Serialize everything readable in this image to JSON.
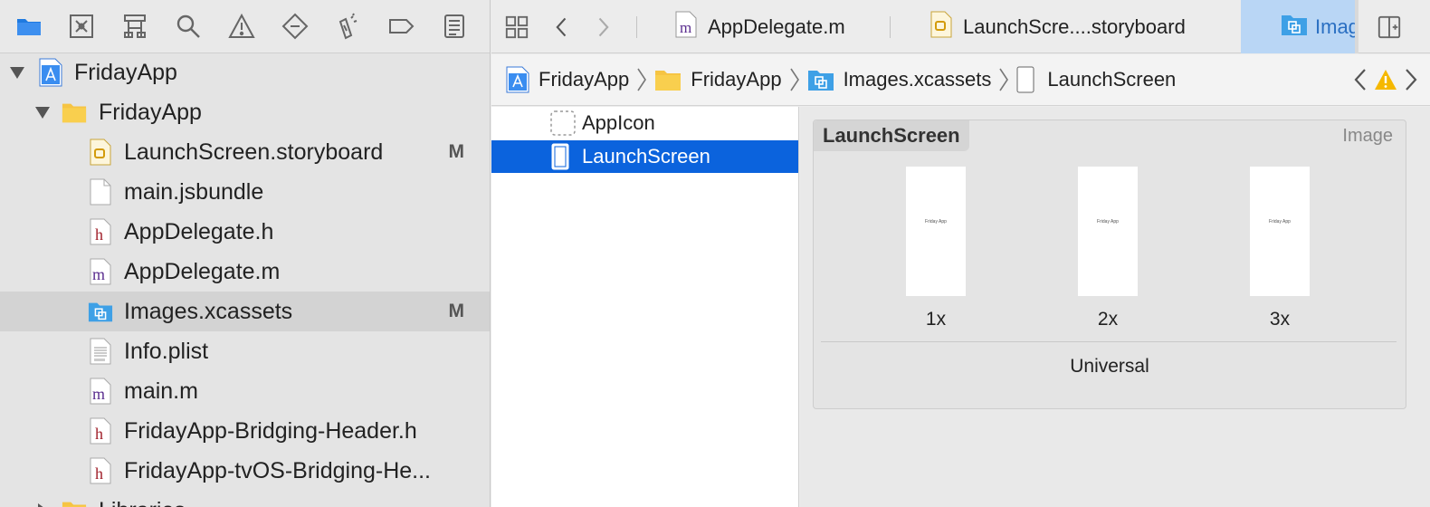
{
  "navigator": {
    "toolbar": [
      {
        "name": "project-navigator-icon",
        "active": true
      },
      {
        "name": "source-control-icon",
        "active": false
      },
      {
        "name": "symbol-navigator-icon",
        "active": false
      },
      {
        "name": "find-navigator-icon",
        "active": false
      },
      {
        "name": "issue-navigator-icon",
        "active": false
      },
      {
        "name": "test-navigator-icon",
        "active": false
      },
      {
        "name": "debug-navigator-icon",
        "active": false
      },
      {
        "name": "breakpoint-navigator-icon",
        "active": false
      },
      {
        "name": "report-navigator-icon",
        "active": false
      }
    ],
    "rows": [
      {
        "label": "FridayApp",
        "icon": "project-icon",
        "level": 0,
        "disclosure": "down",
        "badge": ""
      },
      {
        "label": "FridayApp",
        "icon": "folder-icon",
        "level": 1,
        "disclosure": "down",
        "badge": ""
      },
      {
        "label": "LaunchScreen.storyboard",
        "icon": "storyboard-file-icon",
        "level": 2,
        "disclosure": "",
        "badge": "M"
      },
      {
        "label": "main.jsbundle",
        "icon": "plain-file-icon",
        "level": 2,
        "disclosure": "",
        "badge": ""
      },
      {
        "label": "AppDelegate.h",
        "icon": "header-file-icon",
        "level": 2,
        "disclosure": "",
        "badge": ""
      },
      {
        "label": "AppDelegate.m",
        "icon": "objc-file-icon",
        "level": 2,
        "disclosure": "",
        "badge": ""
      },
      {
        "label": "Images.xcassets",
        "icon": "asset-catalog-icon",
        "level": 2,
        "disclosure": "",
        "badge": "M",
        "selected": true
      },
      {
        "label": "Info.plist",
        "icon": "plist-file-icon",
        "level": 2,
        "disclosure": "",
        "badge": ""
      },
      {
        "label": "main.m",
        "icon": "objc-file-icon",
        "level": 2,
        "disclosure": "",
        "badge": ""
      },
      {
        "label": "FridayApp-Bridging-Header.h",
        "icon": "header-file-icon",
        "level": 2,
        "disclosure": "",
        "badge": ""
      },
      {
        "label": "FridayApp-tvOS-Bridging-He...",
        "icon": "header-file-icon",
        "level": 2,
        "disclosure": "",
        "badge": ""
      },
      {
        "label": "Libraries",
        "icon": "folder-icon",
        "level": 1,
        "disclosure": "right",
        "badge": ""
      }
    ]
  },
  "tabs": [
    {
      "label": "AppDelegate.m",
      "icon": "objc-file-icon"
    },
    {
      "label": "LaunchScre....storyboard",
      "icon": "storyboard-file-icon"
    },
    {
      "label": "Imag",
      "icon": "asset-catalog-icon",
      "active": true
    }
  ],
  "jumpbar": {
    "crumbs": [
      {
        "label": "FridayApp",
        "icon": "project-icon"
      },
      {
        "label": "FridayApp",
        "icon": "folder-icon"
      },
      {
        "label": "Images.xcassets",
        "icon": "asset-catalog-icon"
      },
      {
        "label": "LaunchScreen",
        "icon": "image-set-icon"
      }
    ]
  },
  "asset_list": [
    {
      "label": "AppIcon",
      "icon": "app-icon-set-icon",
      "selected": false
    },
    {
      "label": "LaunchScreen",
      "icon": "image-set-icon",
      "selected": true
    }
  ],
  "detail": {
    "set_name": "LaunchScreen",
    "set_type": "Image",
    "slots": [
      {
        "scale": "1x",
        "caption": "Friday App"
      },
      {
        "scale": "2x",
        "caption": "Friday App"
      },
      {
        "scale": "3x",
        "caption": "Friday App"
      }
    ],
    "group_label": "Universal"
  },
  "colors": {
    "selection_blue": "#0b63dd",
    "active_tab": "#b9d6f5",
    "folder_yellow": "#f6c443",
    "asset_blue": "#3ea0e6",
    "warning_yellow": "#f5b800"
  }
}
